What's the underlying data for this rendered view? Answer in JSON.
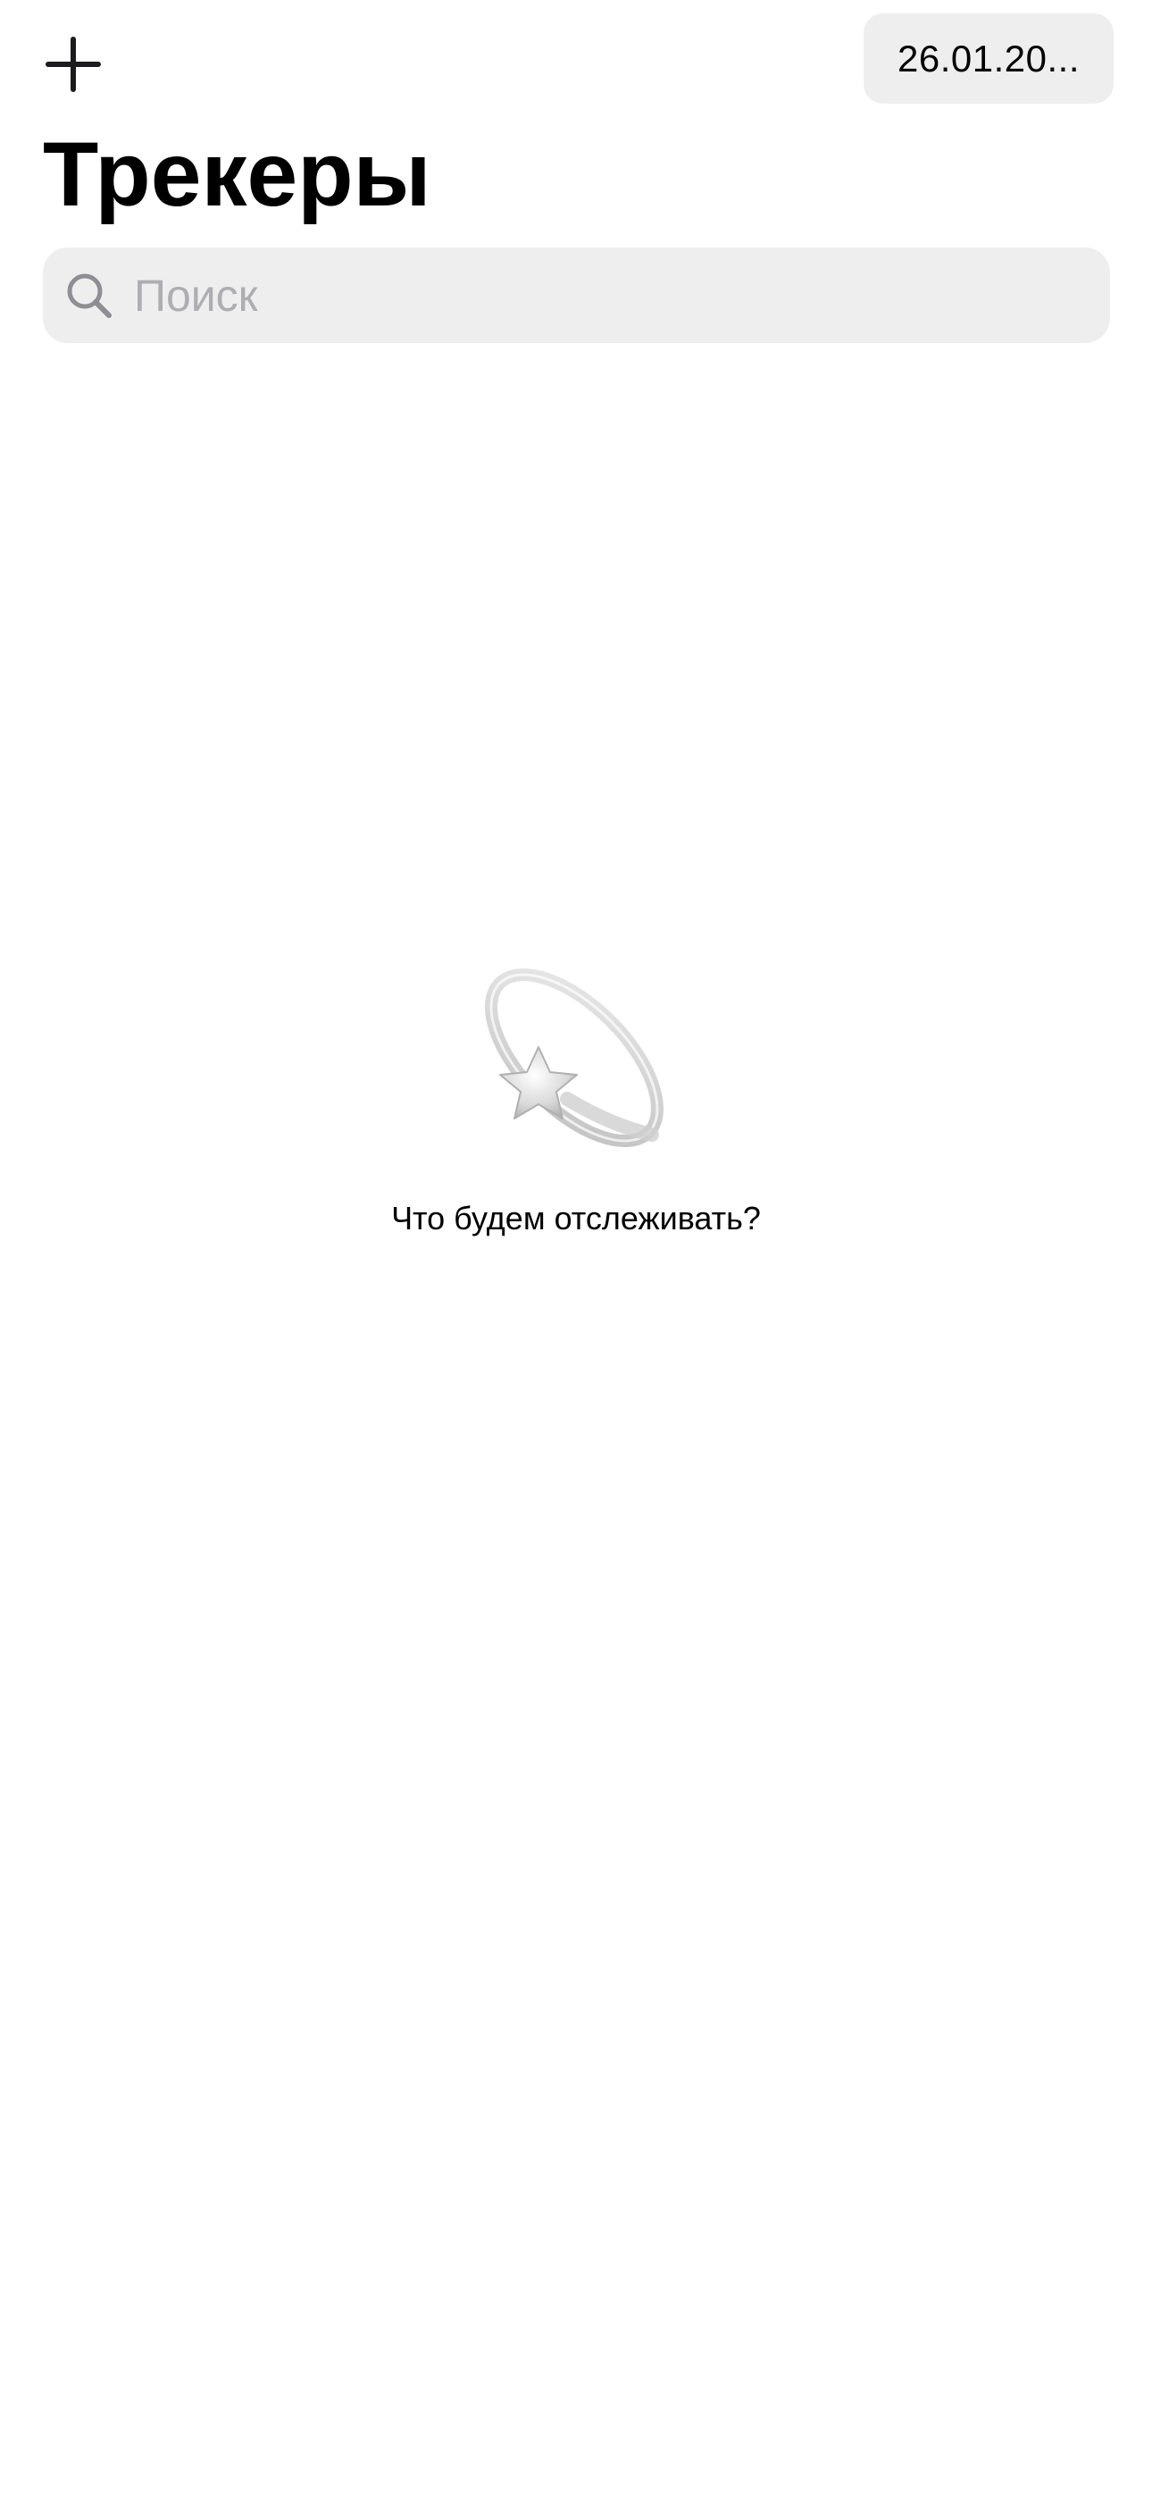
{
  "header": {
    "add_icon": "plus-icon",
    "date_label": "26.01.20..."
  },
  "title": "Трекеры",
  "search": {
    "icon": "magnifier-icon",
    "placeholder": "Поиск",
    "value": ""
  },
  "empty_state": {
    "illustration": "dizzy-star-icon",
    "message": "Что будем отслеживать?"
  },
  "colors": {
    "field_background": "#eeeeef",
    "placeholder": "#aeaeb2",
    "icon_dark": "#1c1c1e",
    "text": "#000000"
  }
}
